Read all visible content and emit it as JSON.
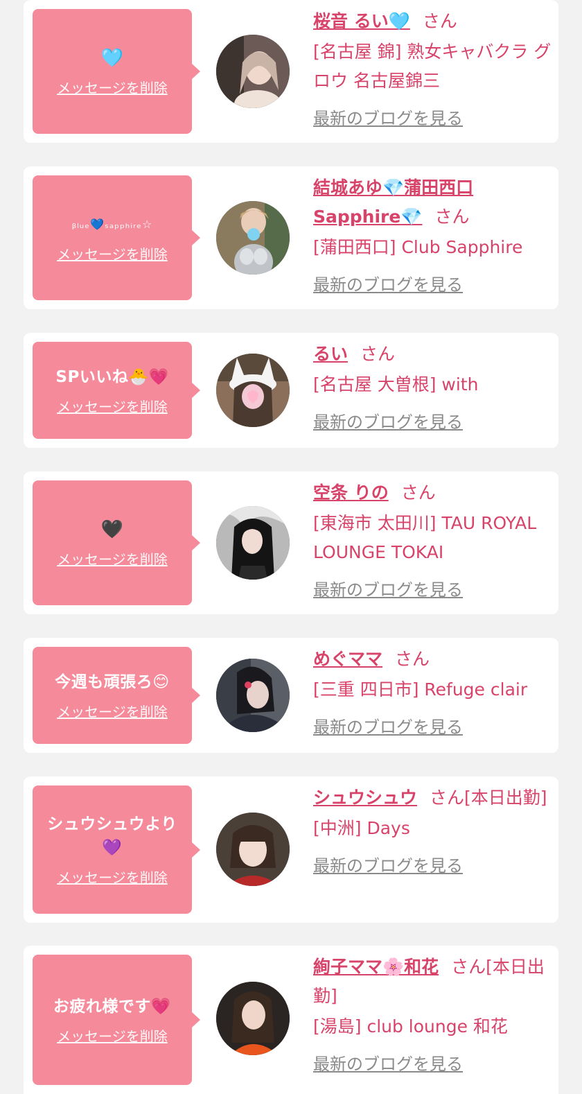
{
  "common": {
    "delete_label": "メッセージを削除",
    "blog_label": "最新のブログを見る"
  },
  "colors": {
    "bubble": "#f58a9b",
    "accent": "#d8436a",
    "link_gray": "#8a8a8a",
    "page_bg": "#f2f2f2"
  },
  "messages": [
    {
      "message": "🩵",
      "name": "桜音 るい🩵",
      "honorific": "さん",
      "shop": "[名古屋 錦] 熟女キャバクラ グロウ 名古屋錦三"
    },
    {
      "message": "ᵦₗᵤₑ💙ₛₐₚₚₕᵢᵣₑ☆",
      "name": "結城あゆ💎蒲田西口Sapphire💎",
      "honorific": "さん",
      "shop": "[蒲田西口] Club Sapphire"
    },
    {
      "message": "SPいいね🐣💗",
      "name": "るい",
      "honorific": "さん",
      "shop": "[名古屋 大曽根] with"
    },
    {
      "message": "🖤",
      "name": "空条 りの",
      "honorific": "さん",
      "shop": "[東海市 太田川] TAU ROYAL LOUNGE TOKAI"
    },
    {
      "message": "今週も頑張ろ😊",
      "name": "めぐママ",
      "honorific": "さん",
      "shop": "[三重 四日市] Refuge clair"
    },
    {
      "message": "シュウシュウより💜",
      "name": "シュウシュウ",
      "honorific": "さん[本日出勤]",
      "shop": "[中洲] Days"
    },
    {
      "message": "お疲れ様です💗",
      "name": "絢子ママ🌸和花",
      "honorific": "さん[本日出勤]",
      "shop": "[湯島] club lounge 和花"
    }
  ]
}
